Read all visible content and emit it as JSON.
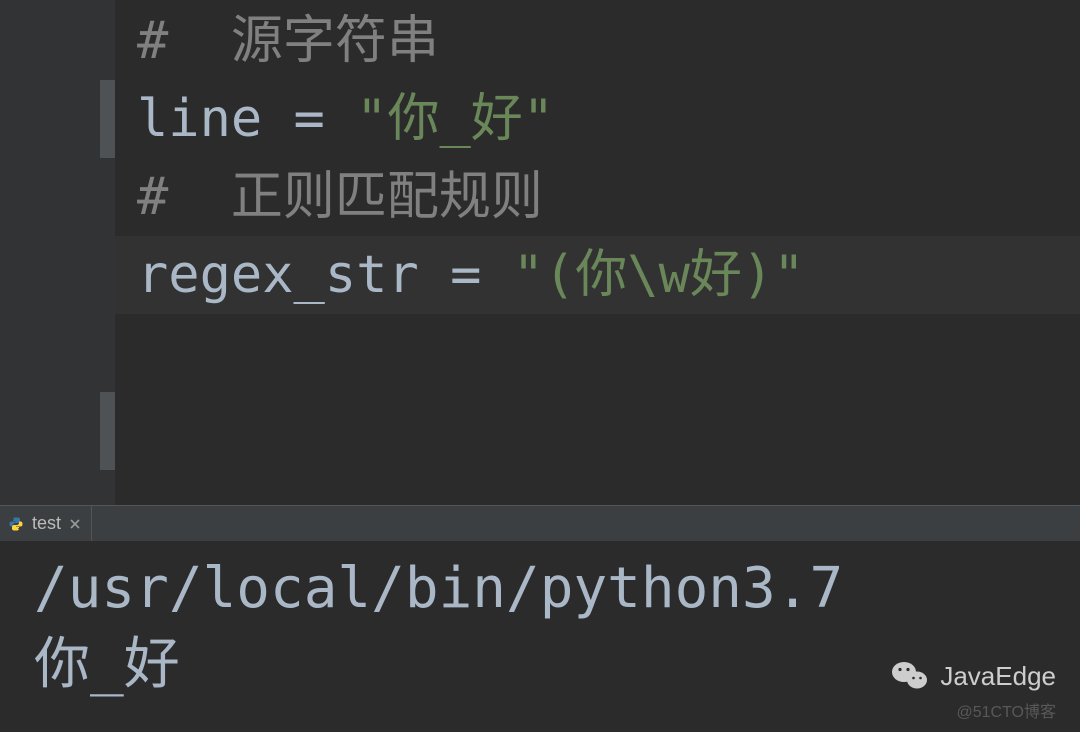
{
  "editor": {
    "lines": {
      "comment1": "#  源字符串",
      "assign1_ident": "line",
      "assign1_op": " = ",
      "assign1_string": "\"你_好\"",
      "blank": "",
      "comment2": "#  正则匹配规则",
      "assign2_ident": "regex_str",
      "assign2_op": " = ",
      "assign2_string": "\"(你\\w好)\""
    }
  },
  "tabs": {
    "run_tab_label": "test"
  },
  "console": {
    "line1": "/usr/local/bin/python3.7",
    "line2": "你_好"
  },
  "watermark": {
    "wechat_label": "JavaEdge",
    "blog_label": "@51CTO博客"
  }
}
